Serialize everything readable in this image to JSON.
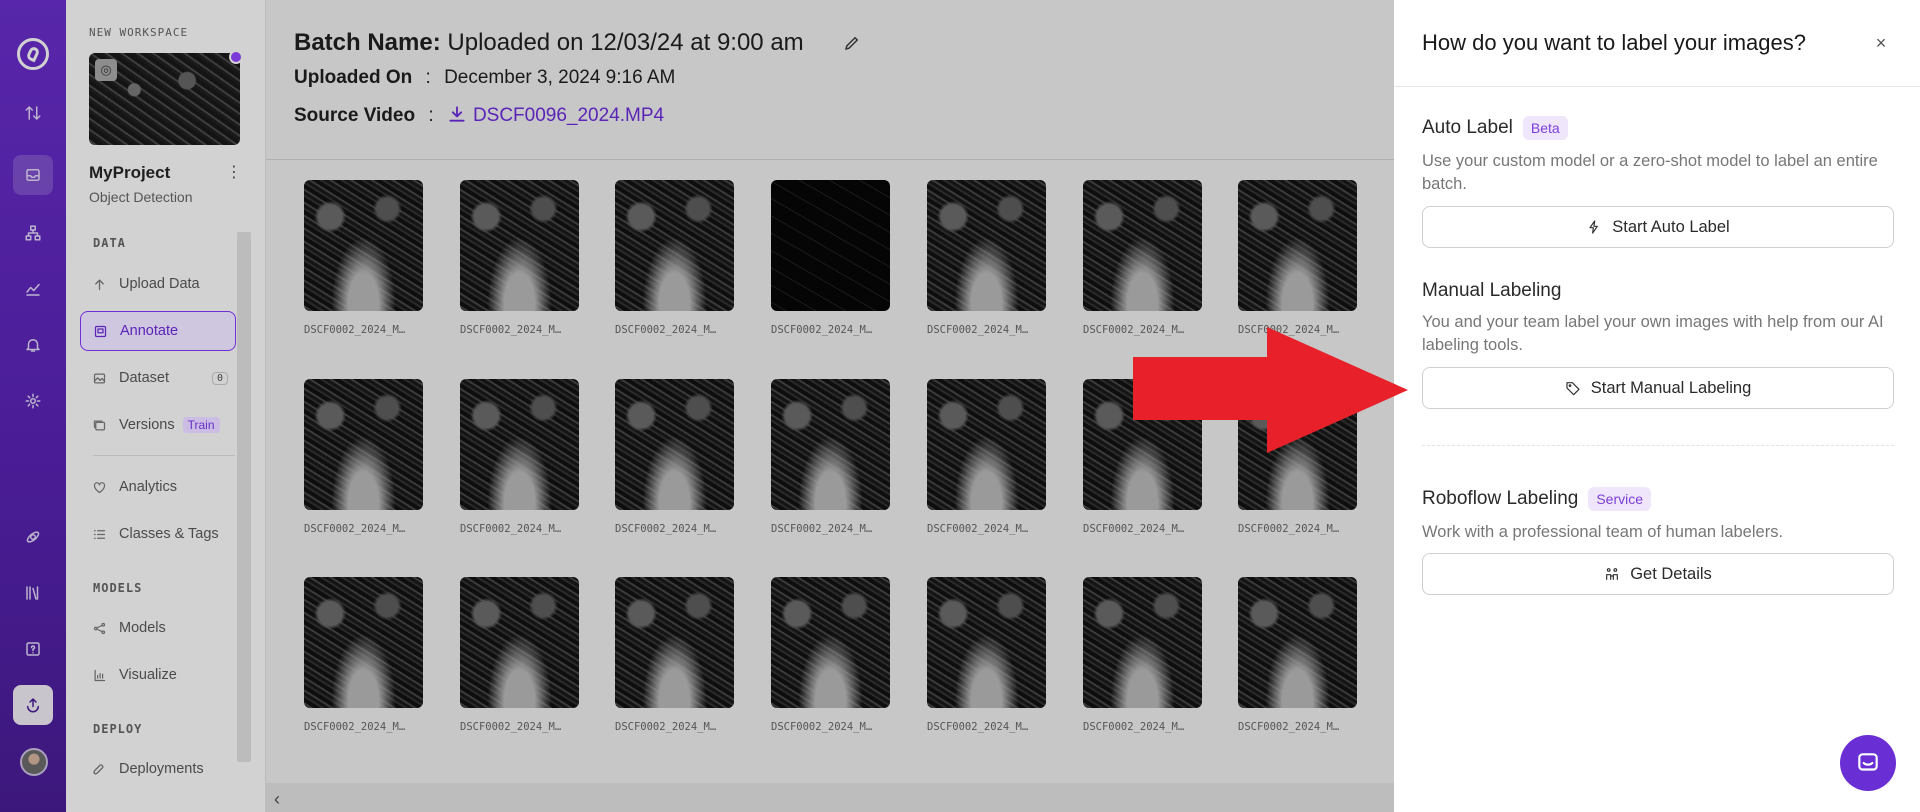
{
  "sidebar": {
    "workspace_label": "NEW WORKSPACE",
    "project_name": "MyProject",
    "project_type": "Object Detection",
    "sections": {
      "data": "DATA",
      "models": "MODELS",
      "deploy": "DEPLOY"
    },
    "items": [
      {
        "label": "Upload Data",
        "icon": "upload-icon"
      },
      {
        "label": "Annotate",
        "icon": "annotate-icon",
        "active": true
      },
      {
        "label": "Dataset",
        "icon": "image-icon",
        "count": "0"
      },
      {
        "label": "Versions",
        "icon": "versions-icon",
        "tag": "Train"
      },
      {
        "label": "Analytics",
        "icon": "heart-chart-icon"
      },
      {
        "label": "Classes & Tags",
        "icon": "list-icon"
      },
      {
        "label": "Models",
        "icon": "nodes-icon"
      },
      {
        "label": "Visualize",
        "icon": "bars-icon"
      },
      {
        "label": "Deployments",
        "icon": "rocket-icon"
      }
    ]
  },
  "header": {
    "batch_label": "Batch Name:",
    "batch_value": "Uploaded on 12/03/24 at 9:00 am",
    "uploaded_label": "Uploaded On",
    "uploaded_value": "December 3, 2024 9:16 AM",
    "source_label": "Source Video",
    "source_value": "DSCF0096_2024.MP4",
    "separator": ":"
  },
  "images": {
    "caption": "DSCF0002_2024_M…",
    "rows": 3,
    "cols": 7
  },
  "drawer": {
    "title": "How do you want to label your images?",
    "close": "×",
    "auto": {
      "title": "Auto Label",
      "badge": "Beta",
      "desc": "Use your custom model or a zero-shot model to label an entire batch.",
      "button": "Start Auto Label"
    },
    "manual": {
      "title": "Manual Labeling",
      "desc": "You and your team label your own images with help from our AI labeling tools.",
      "button": "Start Manual Labeling"
    },
    "roboflow": {
      "title": "Roboflow Labeling",
      "badge": "Service",
      "desc": "Work with a professional team of human labelers.",
      "button": "Get Details"
    }
  },
  "colors": {
    "brand": "#6a2fd4",
    "annotation_arrow": "#e8202a"
  }
}
